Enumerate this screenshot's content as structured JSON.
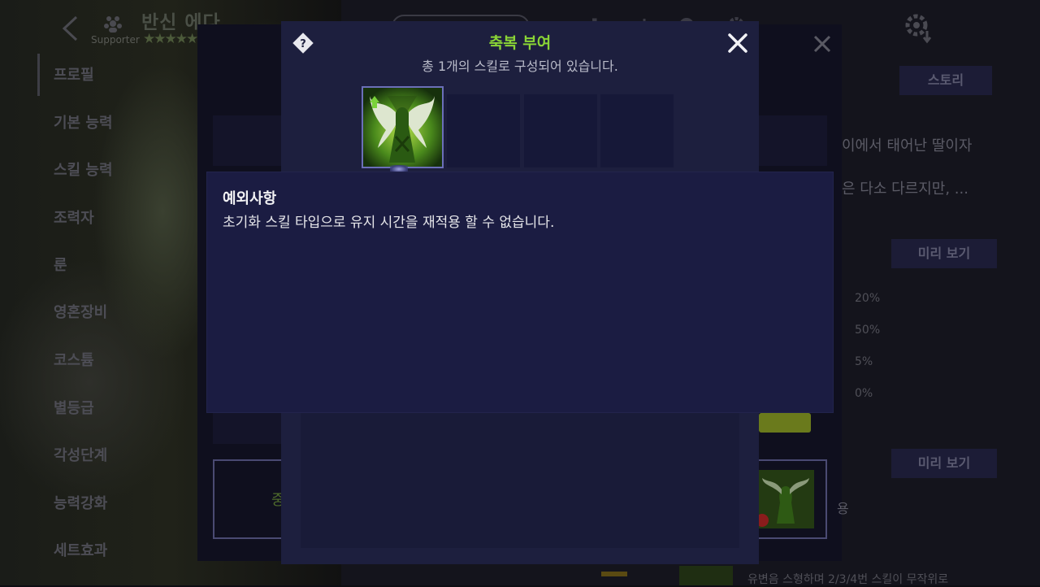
{
  "character": {
    "name": "반신 에다",
    "role": "Supporter",
    "stars": "★★★★★"
  },
  "side_menu": {
    "items": [
      "프로필",
      "기본 능력",
      "스킬 능력",
      "조력자",
      "룬",
      "영혼장비",
      "코스튬",
      "별등급",
      "각성단계",
      "능력강화",
      "세트효과"
    ]
  },
  "background_panel": {
    "story_button": "스토리",
    "preview_button_1": "미리 보기",
    "preview_button_2": "미리 보기",
    "story_line_1": "이에서 태어난 딸이자",
    "story_line_2": "은 다소 다르지만, ...",
    "stats": [
      "20%",
      "50%",
      "5%",
      "0%"
    ],
    "footer_text": "유변음 스형하며 2/3/4번 스킬이 무작위로",
    "side_char": "중"
  },
  "modal": {
    "title": "축복 부여",
    "subtitle": "총 1개의 스킬로 구성되어 있습니다.",
    "help_icon": "question-diamond-icon",
    "close_icon": "close-x-icon"
  },
  "tooltip": {
    "title": "예외사항",
    "body": "초기화 스킬 타입으로 유지 시간을 재적용 할 수 없습니다."
  },
  "colors": {
    "title_green": "#8ad436",
    "modal_bg": "#1d1f3e",
    "tooltip_bg": "#1b1c42",
    "slot_border": "#6b6fb8"
  }
}
